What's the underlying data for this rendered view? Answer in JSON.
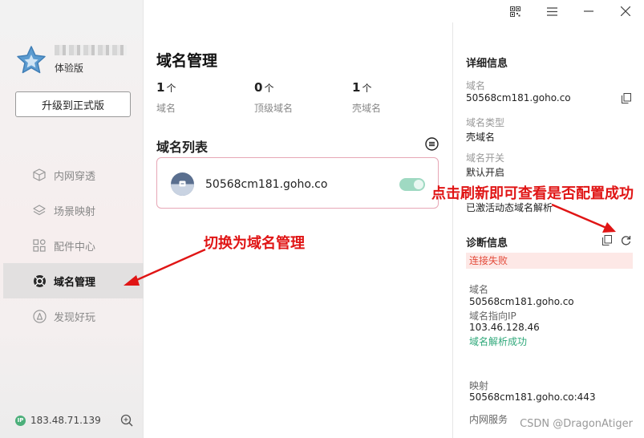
{
  "window": {
    "controls": [
      "qr-code-icon",
      "menu-icon",
      "minimize-icon",
      "close-icon"
    ]
  },
  "sidebar": {
    "user_level": "体验版",
    "upgrade_label": "升级到正式版",
    "items": [
      {
        "label": "内网穿透",
        "icon": "cube-icon",
        "active": false
      },
      {
        "label": "场景映射",
        "icon": "layers-icon",
        "active": false
      },
      {
        "label": "配件中心",
        "icon": "grid-icon",
        "active": false
      },
      {
        "label": "域名管理",
        "icon": "domain-icon",
        "active": true
      },
      {
        "label": "发现好玩",
        "icon": "compass-icon",
        "active": false
      }
    ],
    "ip_badge": "IP",
    "ip": "183.48.71.139"
  },
  "main": {
    "title": "域名管理",
    "stats": [
      {
        "value": "1",
        "unit": "个",
        "label": "域名"
      },
      {
        "value": "0",
        "unit": "个",
        "label": "顶级域名"
      },
      {
        "value": "1",
        "unit": "个",
        "label": "壳域名"
      }
    ],
    "list_title": "域名列表",
    "domain": {
      "name": "50568cm181.goho.co",
      "enabled": true
    }
  },
  "detail": {
    "title": "详细信息",
    "domain_label": "域名",
    "domain_value": "50568cm181.goho.co",
    "type_label": "域名类型",
    "type_value": "壳域名",
    "switch_label": "域名开关",
    "switch_value": "默认开启",
    "ddns_value": "已激活动态域名解析",
    "diag_title": "诊断信息",
    "diag_status": "连接失败",
    "diag_domain_label": "域名",
    "diag_domain_value": "50568cm181.goho.co",
    "diag_ip_label": "域名指向IP",
    "diag_ip_value": "103.46.128.46",
    "diag_resolve": "域名解析成功",
    "map_label": "映射",
    "map_value": "50568cm181.goho.co:443",
    "lan_label": "内网服务"
  },
  "annotations": {
    "switch_hint": "切换为域名管理",
    "refresh_hint": "点击刷新即可查看是否配置成功",
    "color": "#e01515"
  },
  "watermark": "CSDN @DragonAtiger"
}
